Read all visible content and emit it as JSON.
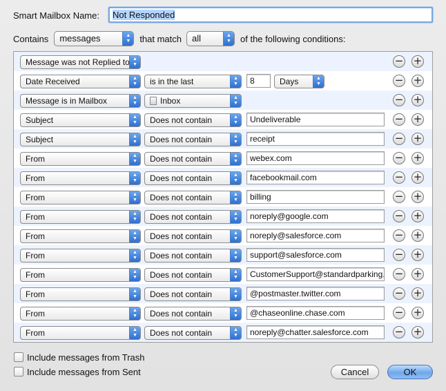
{
  "header": {
    "name_label": "Smart Mailbox Name:",
    "name_value": "Not Responded",
    "contains_label": "Contains",
    "contains_value": "messages",
    "that_match_label": "that match",
    "match_value": "all",
    "conditions_suffix": "of the following conditions:"
  },
  "conditions": [
    {
      "field": "Message was not Replied to",
      "op": "",
      "value": "",
      "unit": ""
    },
    {
      "field": "Date Received",
      "op": "is in the last",
      "value": "8",
      "unit": "Days"
    },
    {
      "field": "Message is in Mailbox",
      "op": "Inbox",
      "value": "",
      "unit": ""
    },
    {
      "field": "Subject",
      "op": "Does not contain",
      "value": "Undeliverable",
      "unit": ""
    },
    {
      "field": "Subject",
      "op": "Does not contain",
      "value": "receipt",
      "unit": ""
    },
    {
      "field": "From",
      "op": "Does not contain",
      "value": "webex.com",
      "unit": ""
    },
    {
      "field": "From",
      "op": "Does not contain",
      "value": "facebookmail.com",
      "unit": ""
    },
    {
      "field": "From",
      "op": "Does not contain",
      "value": "billing",
      "unit": ""
    },
    {
      "field": "From",
      "op": "Does not contain",
      "value": "noreply@google.com",
      "unit": ""
    },
    {
      "field": "From",
      "op": "Does not contain",
      "value": "noreply@salesforce.com",
      "unit": ""
    },
    {
      "field": "From",
      "op": "Does not contain",
      "value": "support@salesforce.com",
      "unit": ""
    },
    {
      "field": "From",
      "op": "Does not contain",
      "value": "CustomerSupport@standardparking.",
      "unit": ""
    },
    {
      "field": "From",
      "op": "Does not contain",
      "value": "@postmaster.twitter.com",
      "unit": ""
    },
    {
      "field": "From",
      "op": "Does not contain",
      "value": "@chaseonline.chase.com",
      "unit": ""
    },
    {
      "field": "From",
      "op": "Does not contain",
      "value": "noreply@chatter.salesforce.com",
      "unit": ""
    }
  ],
  "row_buttons": {
    "remove": "−",
    "add": "+"
  },
  "options": {
    "include_trash": "Include messages from Trash",
    "include_sent": "Include messages from Sent"
  },
  "buttons": {
    "cancel": "Cancel",
    "ok": "OK"
  },
  "popup_arrows": {
    "up": "▲",
    "down": "▼"
  },
  "icons": {
    "mailbox": "inbox-mailbox-icon"
  }
}
